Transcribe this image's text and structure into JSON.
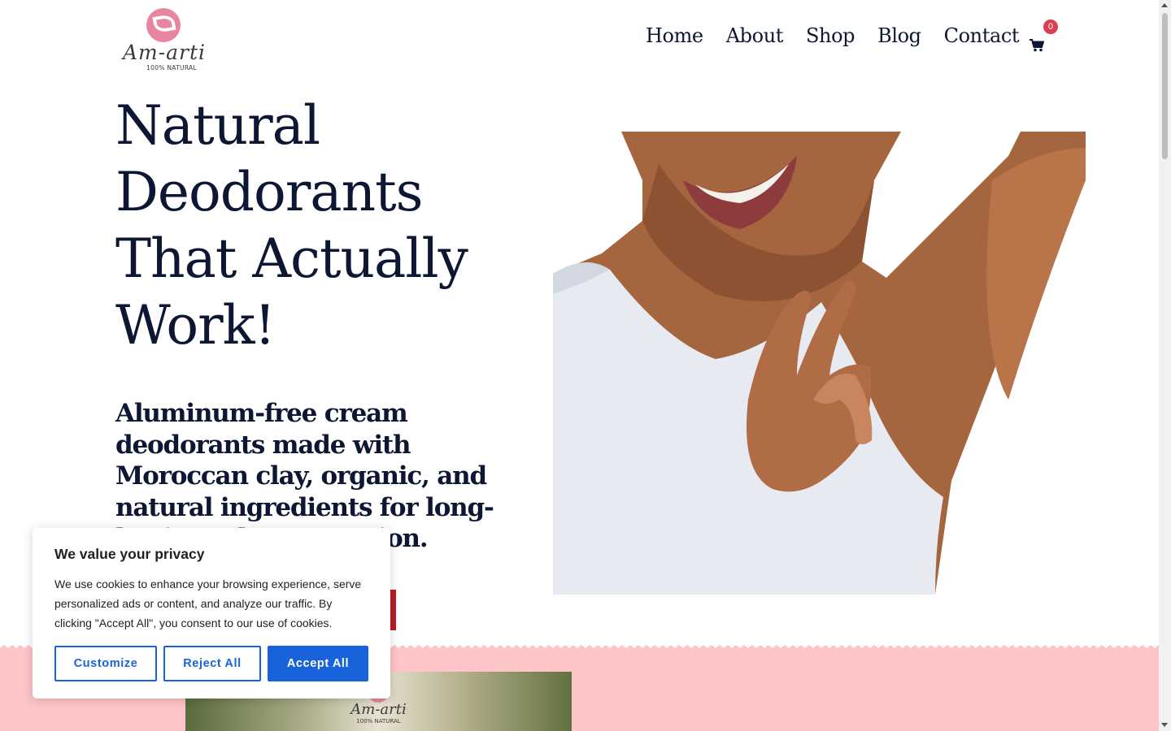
{
  "header": {
    "logo": {
      "name": "Am-arti",
      "tagline": "100% NATURAL"
    },
    "nav": [
      {
        "label": "Home"
      },
      {
        "label": "About"
      },
      {
        "label": "Shop"
      },
      {
        "label": "Blog"
      },
      {
        "label": "Contact"
      }
    ],
    "cart": {
      "icon": "shopping-cart-icon",
      "count": "0",
      "badge_color": "#d9404f"
    }
  },
  "hero": {
    "title": "Natural Deodorants That Actually Work!",
    "subtitle": "Aluminum-free cream deodorants made with Moroccan clay, organic, and natural ingredients for long-lasting odor protection.",
    "button_color": "#b91c24",
    "image": "woman-ok-gesture-photo"
  },
  "product_section": {
    "background": "#fec5c8",
    "product_logo": "Am-arti",
    "product_tagline": "100% NATURAL"
  },
  "cookie_banner": {
    "title": "We value your privacy",
    "text": "We use cookies to enhance your browsing experience, serve personalized ads or content, and analyze our traffic. By clicking \"Accept All\", you consent to our use of cookies.",
    "buttons": {
      "customize": "Customize",
      "reject": "Reject All",
      "accept": "Accept All"
    },
    "accent": "#1863dc"
  },
  "colors": {
    "text_navy": "#0d1733",
    "logo_pink": "#e8869f"
  }
}
